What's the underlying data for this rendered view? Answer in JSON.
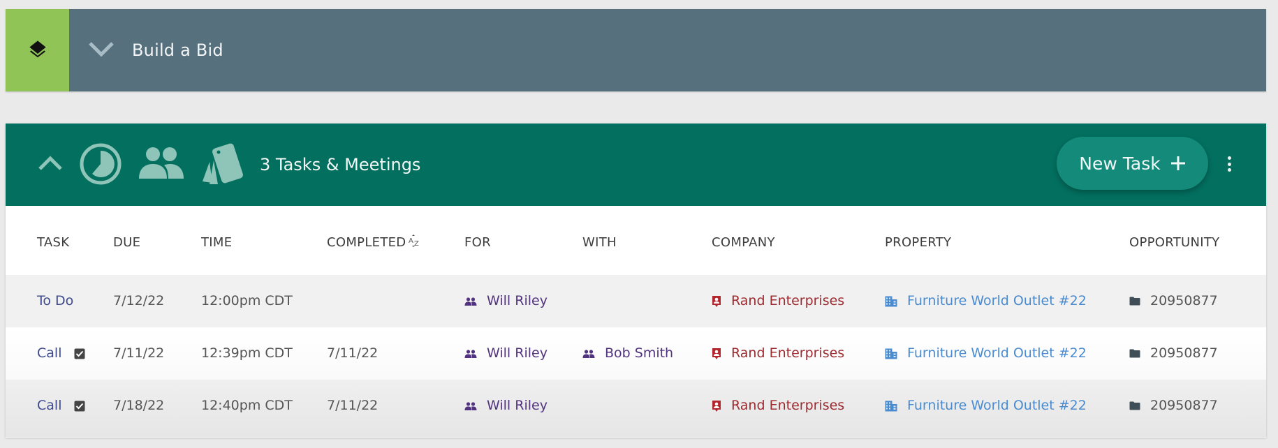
{
  "top_section": {
    "title": "Build a Bid",
    "badge_icon": "layers-icon",
    "toggle_icon": "chevron-down-icon"
  },
  "tasks_panel": {
    "title": "3 Tasks & Meetings",
    "icons": [
      "chevron-up-icon",
      "clock-icon",
      "people-icon",
      "cards-icon"
    ],
    "new_task_label": "New Task",
    "new_task_icon": "plus-icon",
    "menu_icon": "kebab-menu-icon",
    "columns": [
      {
        "key": "task",
        "label": "TASK"
      },
      {
        "key": "due",
        "label": "DUE"
      },
      {
        "key": "time",
        "label": "TIME"
      },
      {
        "key": "completed",
        "label": "COMPLETED",
        "sort_icon": "sort-az-icon"
      },
      {
        "key": "for",
        "label": "FOR"
      },
      {
        "key": "with",
        "label": "WITH"
      },
      {
        "key": "company",
        "label": "COMPANY"
      },
      {
        "key": "property",
        "label": "PROPERTY"
      },
      {
        "key": "opportunity",
        "label": "OPPORTUNITY"
      }
    ],
    "rows": [
      {
        "task": "To Do",
        "completed_check": false,
        "due": "7/12/22",
        "time": "12:00pm CDT",
        "completed": "",
        "for": "Will Riley",
        "with": "",
        "company": "Rand Enterprises",
        "property": "Furniture World Outlet #22",
        "opportunity": "20950877"
      },
      {
        "task": "Call",
        "completed_check": true,
        "due": "7/11/22",
        "time": "12:39pm CDT",
        "completed": "7/11/22",
        "for": "Will Riley",
        "with": "Bob Smith",
        "company": "Rand Enterprises",
        "property": "Furniture World Outlet #22",
        "opportunity": "20950877"
      },
      {
        "task": "Call",
        "completed_check": true,
        "due": "7/18/22",
        "time": "12:40pm CDT",
        "completed": "7/11/22",
        "for": "Will Riley",
        "with": "",
        "company": "Rand Enterprises",
        "property": "Furniture World Outlet #22",
        "opportunity": "20950877"
      }
    ]
  },
  "colors": {
    "background": "#ebeaea",
    "top_bar": "#56707e",
    "badge_green": "#90c456",
    "panel_header": "#036f5f",
    "button": "#138a7a",
    "header_icon": "#8ec5b8",
    "task_link": "#3e4a8d",
    "person_link": "#52337f",
    "company_link": "#9c2a2f",
    "property_link": "#4a8bd0"
  }
}
